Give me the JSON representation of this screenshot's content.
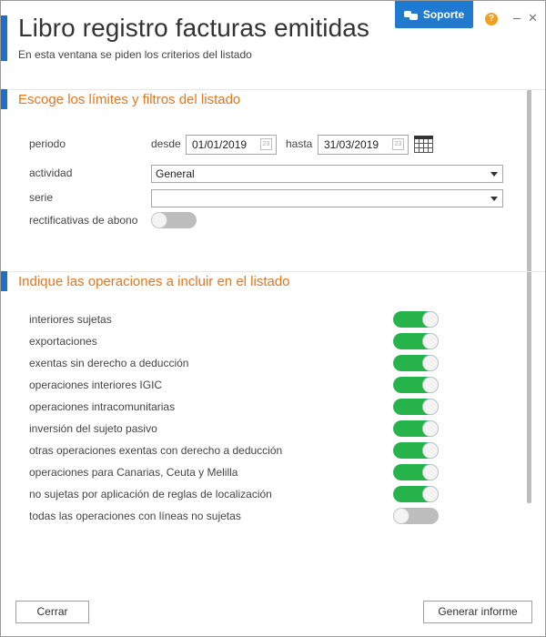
{
  "header": {
    "title": "Libro registro facturas emitidas",
    "subtitle": "En esta ventana se piden los criterios del listado",
    "support_label": "Soporte",
    "help_glyph": "?",
    "minimize_glyph": "–",
    "close_glyph": "✕"
  },
  "section_limits": {
    "title": "Escoge los límites y filtros del listado",
    "periodo_label": "periodo",
    "desde_label": "desde",
    "desde_value": "01/01/2019",
    "hasta_label": "hasta",
    "hasta_value": "31/03/2019",
    "actividad_label": "actividad",
    "actividad_value": "General",
    "serie_label": "serie",
    "serie_value": "",
    "rectificativas_label": "rectificativas de abono",
    "rectificativas_on": false
  },
  "section_operations": {
    "title": "Indique las operaciones a incluir en el listado",
    "items": [
      {
        "label": "interiores sujetas",
        "on": true
      },
      {
        "label": "exportaciones",
        "on": true
      },
      {
        "label": "exentas sin derecho a deducción",
        "on": true
      },
      {
        "label": "operaciones interiores IGIC",
        "on": true
      },
      {
        "label": "operaciones intracomunitarias",
        "on": true
      },
      {
        "label": "inversión del sujeto pasivo",
        "on": true
      },
      {
        "label": "otras operaciones exentas con derecho a deducción",
        "on": true
      },
      {
        "label": "operaciones para Canarias, Ceuta y Melilla",
        "on": true
      },
      {
        "label": "no sujetas por aplicación de reglas de localización",
        "on": true
      },
      {
        "label": "todas las operaciones con líneas no sujetas",
        "on": false
      }
    ]
  },
  "footer": {
    "close_label": "Cerrar",
    "generate_label": "Generar informe"
  },
  "colors": {
    "accent_blue": "#1f6fc6",
    "section_orange": "#e3771f",
    "toggle_on": "#26b34a",
    "toggle_off": "#bdbdbd"
  }
}
